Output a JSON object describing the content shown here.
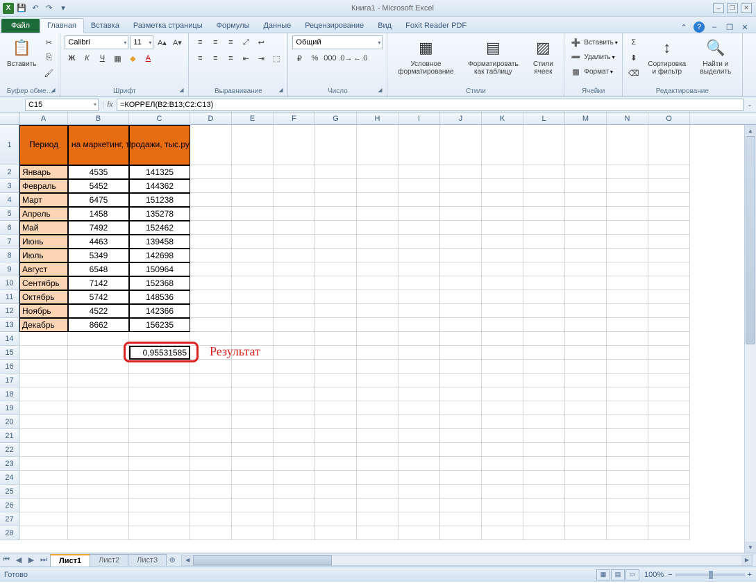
{
  "title": "Книга1 - Microsoft Excel",
  "qat": {
    "save": "💾",
    "undo": "↶",
    "redo": "↷"
  },
  "tabs": {
    "file": "Файл",
    "list": [
      "Главная",
      "Вставка",
      "Разметка страницы",
      "Формулы",
      "Данные",
      "Рецензирование",
      "Вид",
      "Foxit Reader PDF"
    ],
    "active": 0
  },
  "ribbon": {
    "clipboard": {
      "paste": "Вставить",
      "label": "Буфер обме…"
    },
    "font": {
      "name": "Calibri",
      "size": "11",
      "label": "Шрифт"
    },
    "alignment": {
      "label": "Выравнивание"
    },
    "number": {
      "format": "Общий",
      "label": "Число"
    },
    "styles": {
      "cond": "Условное форматирование",
      "table": "Форматировать как таблицу",
      "cell": "Стили ячеек",
      "label": "Стили"
    },
    "cells": {
      "insert": "Вставить",
      "delete": "Удалить",
      "format": "Формат",
      "label": "Ячейки"
    },
    "editing": {
      "sort": "Сортировка и фильтр",
      "find": "Найти и выделить",
      "label": "Редактирование"
    }
  },
  "namebox": "C15",
  "formula": "=КОРРЕЛ(B2:B13;C2:C13)",
  "columns": [
    "A",
    "B",
    "C",
    "D",
    "E",
    "F",
    "G",
    "H",
    "I",
    "J",
    "K",
    "L",
    "M",
    "N",
    "O"
  ],
  "headers": {
    "period": "Период",
    "cost": "Затраты на маркетинг, тыс. руб.",
    "sales": "Продажи, тыс.руб"
  },
  "data": [
    {
      "m": "Январь",
      "c": "4535",
      "s": "141325"
    },
    {
      "m": "Февраль",
      "c": "5452",
      "s": "144362"
    },
    {
      "m": "Март",
      "c": "6475",
      "s": "151238"
    },
    {
      "m": "Апрель",
      "c": "1458",
      "s": "135278"
    },
    {
      "m": "Май",
      "c": "7492",
      "s": "152462"
    },
    {
      "m": "Июнь",
      "c": "4463",
      "s": "139458"
    },
    {
      "m": "Июль",
      "c": "5349",
      "s": "142698"
    },
    {
      "m": "Август",
      "c": "6548",
      "s": "150964"
    },
    {
      "m": "Сентябрь",
      "c": "7142",
      "s": "152368"
    },
    {
      "m": "Октябрь",
      "c": "5742",
      "s": "148536"
    },
    {
      "m": "Ноябрь",
      "c": "4522",
      "s": "142366"
    },
    {
      "m": "Декабрь",
      "c": "8662",
      "s": "156235"
    }
  ],
  "result": "0,95531585",
  "annotation": "Результат",
  "sheets": [
    "Лист1",
    "Лист2",
    "Лист3"
  ],
  "status": {
    "ready": "Готово",
    "zoom": "100%"
  }
}
